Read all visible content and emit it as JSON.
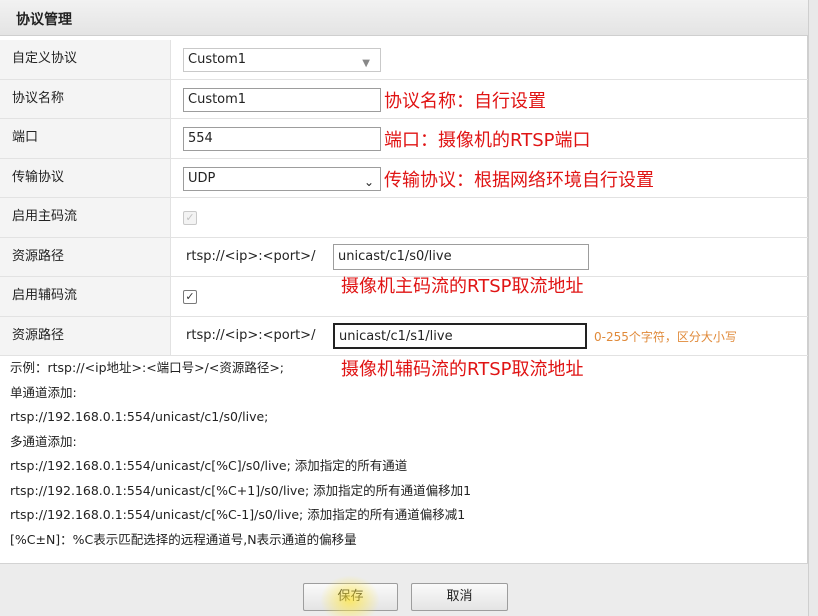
{
  "dialog": {
    "title": "协议管理"
  },
  "form": {
    "custom_protocol": {
      "label": "自定义协议",
      "value": "Custom1"
    },
    "protocol_name": {
      "label": "协议名称",
      "value": "Custom1",
      "annotation": "协议名称：自行设置"
    },
    "port": {
      "label": "端口",
      "value": "554",
      "annotation": "端口：摄像机的RTSP端口"
    },
    "transport": {
      "label": "传输协议",
      "value": "UDP",
      "annotation": "传输协议：根据网络环境自行设置"
    },
    "main_stream": {
      "label": "启用主码流",
      "checked": true,
      "disabled": true
    },
    "main_path": {
      "label": "资源路径",
      "prefix": "rtsp://<ip>:<port>/",
      "value": "unicast/c1/s0/live",
      "annotation": "摄像机主码流的RTSP取流地址"
    },
    "sub_stream": {
      "label": "启用辅码流",
      "checked": true,
      "disabled": false
    },
    "sub_path": {
      "label": "资源路径",
      "prefix": "rtsp://<ip>:<port>/",
      "value": "unicast/c1/s1/live",
      "hint": "0-255个字符，区分大小写",
      "annotation": "摄像机辅码流的RTSP取流地址"
    }
  },
  "examples": {
    "line0": "示例：rtsp://<ip地址>:<端口号>/<资源路径>;",
    "line1": "单通道添加:",
    "line2": "rtsp://192.168.0.1:554/unicast/c1/s0/live;",
    "line3": "多通道添加:",
    "line4": "rtsp://192.168.0.1:554/unicast/c[%C]/s0/live;  添加指定的所有通道",
    "line5": "rtsp://192.168.0.1:554/unicast/c[%C+1]/s0/live;  添加指定的所有通道偏移加1",
    "line6": "rtsp://192.168.0.1:554/unicast/c[%C-1]/s0/live;  添加指定的所有通道偏移减1",
    "line7": "[%C±N]：%C表示匹配选择的远程通道号,N表示通道的偏移量"
  },
  "buttons": {
    "save": "保存",
    "cancel": "取消"
  },
  "colors": {
    "annotation": "#e01414",
    "hint": "#e08a3a"
  }
}
